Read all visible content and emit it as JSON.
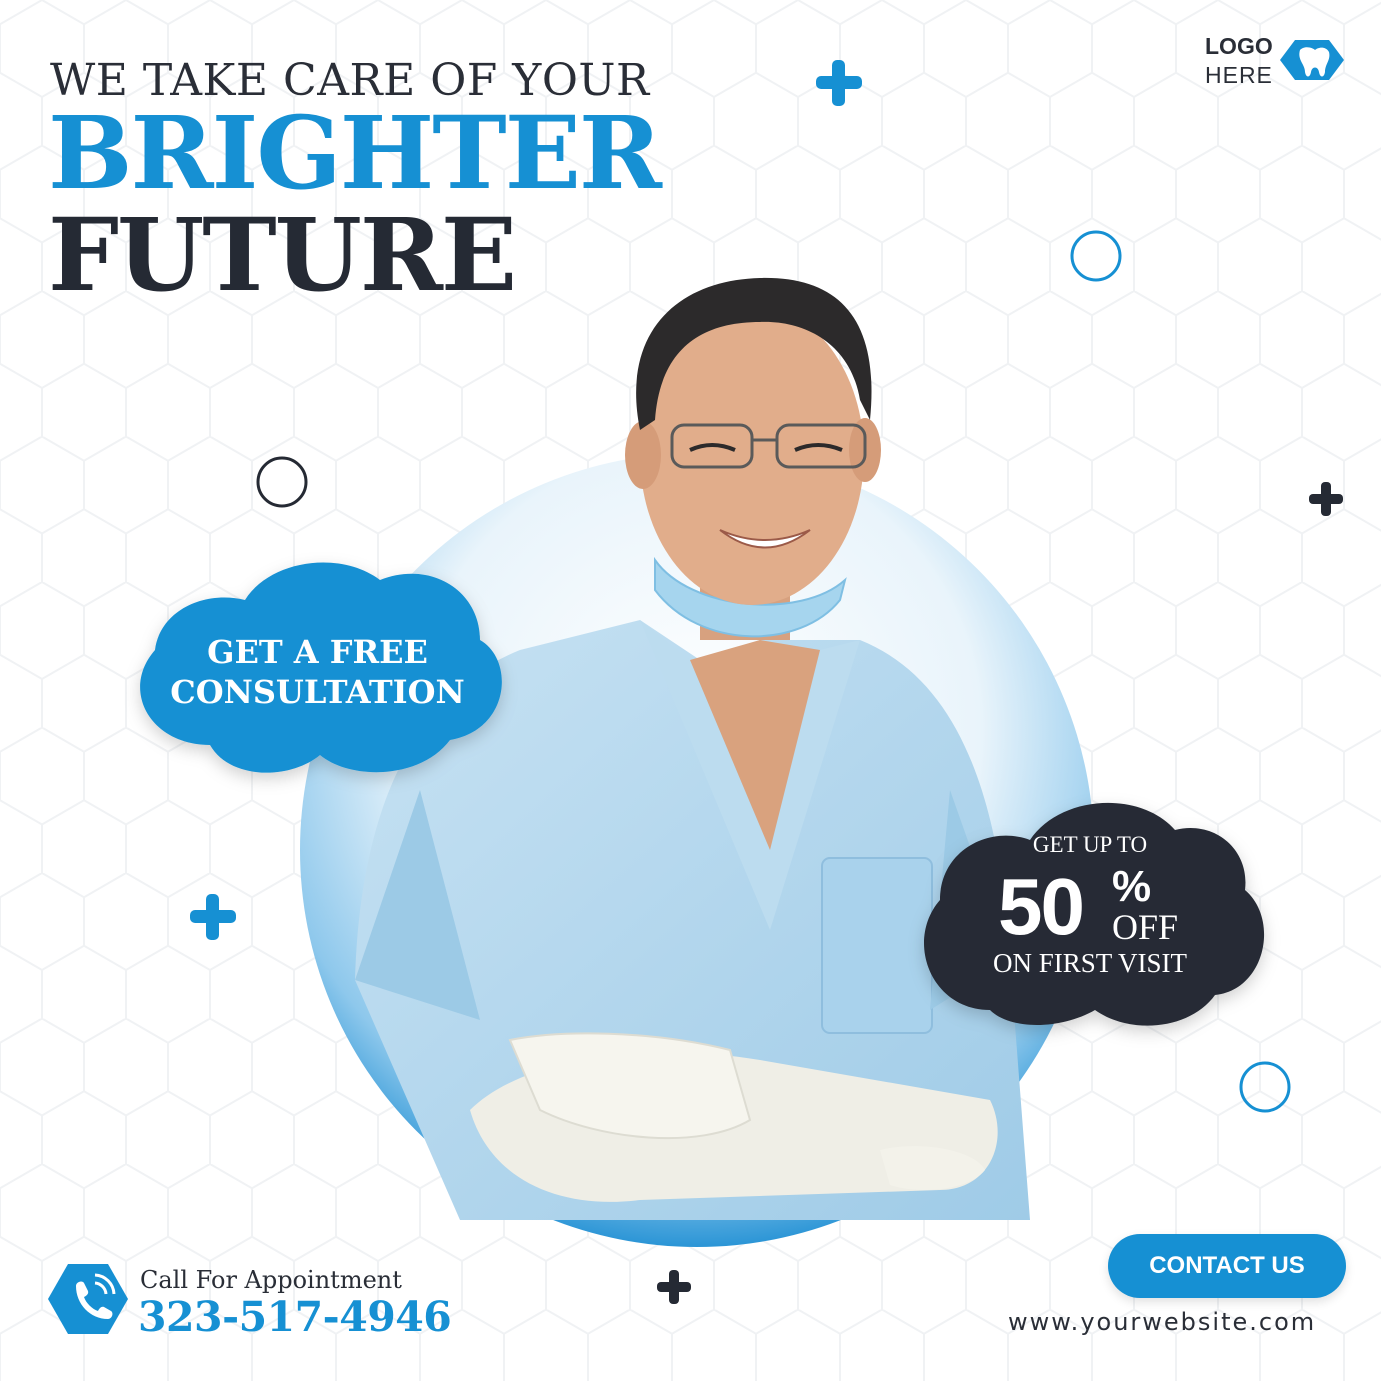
{
  "headline": {
    "line1": "WE TAKE CARE OF YOUR",
    "line2": "BRIGHTER",
    "line3": "FUTURE"
  },
  "logo": {
    "line1": "LOGO",
    "line2": "HERE",
    "icon": "tooth-icon"
  },
  "badge_free": {
    "text_line1": "GET A FREE",
    "text_line2": "CONSULTATION"
  },
  "badge_offer": {
    "pre": "GET UP TO",
    "amount": "50",
    "percent": "%",
    "off": "OFF",
    "post": "ON FIRST VISIT"
  },
  "contact": {
    "label": "Call For Appointment",
    "phone": "323-517-4946",
    "phone_icon": "phone-icon",
    "button": "CONTACT US",
    "website": "www.yourwebsite.com"
  },
  "colors": {
    "brand_blue": "#1690d3",
    "dark": "#252a34",
    "background": "#ffffff"
  }
}
